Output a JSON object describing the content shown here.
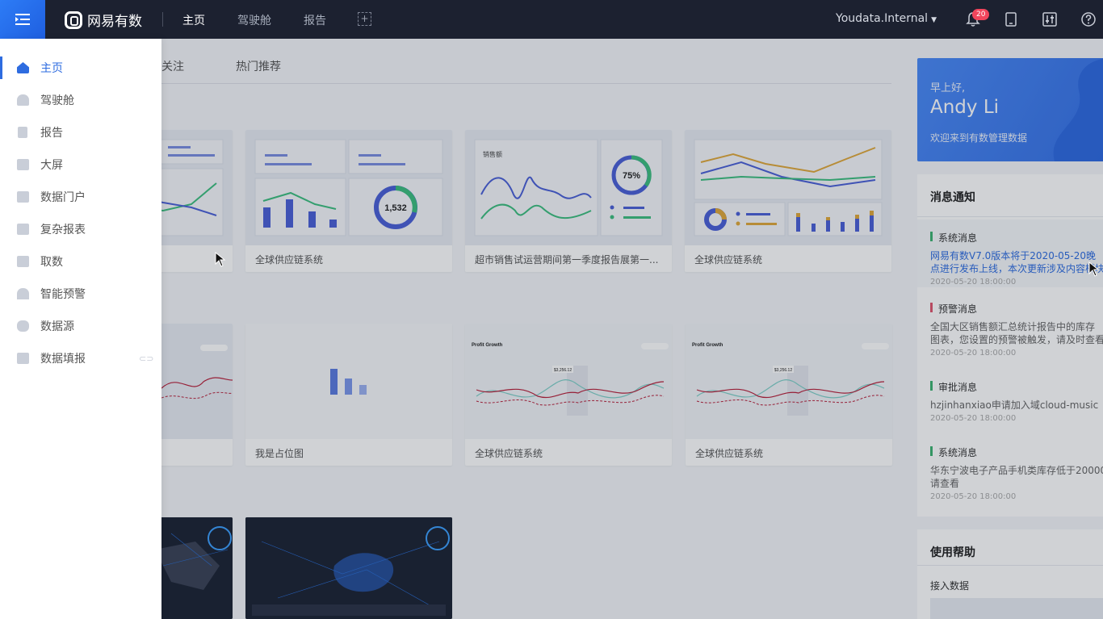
{
  "topbar": {
    "brand": "网易有数",
    "nav": [
      "主页",
      "驾驶舱",
      "报告"
    ],
    "add_symbol": "+",
    "user": "Youdata.Internal",
    "notification_count": "20",
    "icons": [
      "menu-icon",
      "bell-icon",
      "tablet-icon",
      "sliders-icon",
      "help-icon"
    ]
  },
  "tabs": [
    "关注",
    "热门推荐"
  ],
  "cards": {
    "row1": [
      "全球供应链系统",
      "超市销售试运营期间第一季度报告展第一...",
      "全球供应链系统"
    ],
    "row2": [
      "我是占位图",
      "全球供应链系统",
      "全球供应链系统"
    ],
    "thumb_texts": {
      "donut_value": "1,532",
      "sales_label": "销售额",
      "percent": "75%",
      "profit_title": "Profit Growth",
      "tooltip": "$3,256.12"
    }
  },
  "welcome": {
    "greeting": "早上好,",
    "name": "Andy Li",
    "subtitle": "欢迎来到有数管理数据"
  },
  "notifications": {
    "title": "消息通知",
    "items": [
      {
        "type": "系统消息",
        "body1": "网易有数V7.0版本将于2020-05-20晚",
        "body2": "点进行发布上线，本次更新涉及内容模块",
        "time": "2020-05-20  18:00:00",
        "color": "#3cb371"
      },
      {
        "type": "预警消息",
        "body1": "全国大区销售额汇总统计报告中的库存",
        "body2": "图表，您设置的预警被触发，请及时查看",
        "time": "2020-05-20  18:00:00",
        "color": "#e0566f"
      },
      {
        "type": "审批消息",
        "body1": "hzjinhanxiao申请加入域cloud-music",
        "body2": "",
        "time": "2020-05-20  18:00:00",
        "color": "#3cb371"
      },
      {
        "type": "系统消息",
        "body1": "华东宁波电子产品手机类库存低于20000",
        "body2": "请查看",
        "time": "2020-05-20  18:00:00",
        "color": "#3cb371"
      }
    ]
  },
  "help": {
    "title": "使用帮助",
    "item": "接入数据"
  },
  "drawer": {
    "items": [
      {
        "label": "主页",
        "icon": "home-icon"
      },
      {
        "label": "驾驶舱",
        "icon": "dashboard-icon"
      },
      {
        "label": "报告",
        "icon": "report-icon"
      },
      {
        "label": "大屏",
        "icon": "screen-icon"
      },
      {
        "label": "数据门户",
        "icon": "portal-icon"
      },
      {
        "label": "复杂报表",
        "icon": "table-icon"
      },
      {
        "label": "取数",
        "icon": "fetch-icon"
      },
      {
        "label": "智能预警",
        "icon": "alarm-icon"
      },
      {
        "label": "数据源",
        "icon": "database-icon"
      },
      {
        "label": "数据填报",
        "icon": "form-icon"
      }
    ]
  }
}
